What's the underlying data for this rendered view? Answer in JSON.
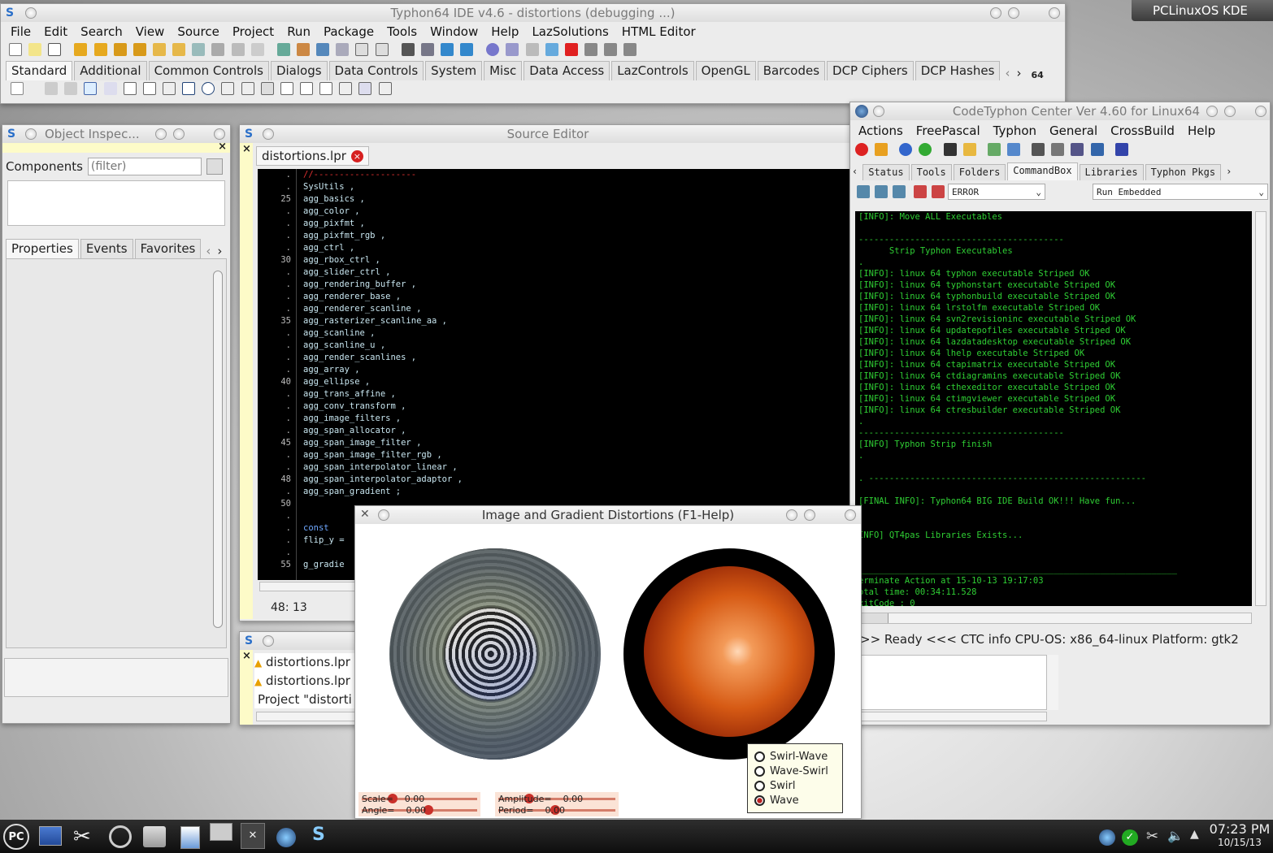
{
  "desktop": {
    "label": "PCLinuxOS KDE"
  },
  "ide": {
    "title": "Typhon64 IDE v4.6 - distortions (debugging ...)",
    "menu": [
      "File",
      "Edit",
      "Search",
      "View",
      "Source",
      "Project",
      "Run",
      "Package",
      "Tools",
      "Window",
      "Help",
      "LazSolutions",
      "HTML Editor"
    ],
    "palette_tabs": [
      "Standard",
      "Additional",
      "Common Controls",
      "Dialogs",
      "Data Controls",
      "System",
      "Misc",
      "Data Access",
      "LazControls",
      "OpenGL",
      "Barcodes",
      "DCP Ciphers",
      "DCP Hashes"
    ],
    "arch_badge": "64"
  },
  "inspector": {
    "title": "Object Inspec...",
    "components_label": "Components",
    "filter_placeholder": "(filter)",
    "tabs": [
      "Properties",
      "Events",
      "Favorites"
    ]
  },
  "editor": {
    "title": "Source Editor",
    "file_tab": "distortions.lpr",
    "status": "48: 13",
    "gutter": [
      ".",
      ".",
      "25",
      ".",
      ".",
      ".",
      ".",
      "30",
      ".",
      ".",
      ".",
      ".",
      "35",
      ".",
      ".",
      ".",
      ".",
      "40",
      ".",
      ".",
      ".",
      ".",
      "45",
      ".",
      ".",
      "48",
      ".",
      "50",
      ".",
      ".",
      ".",
      ".",
      "55"
    ],
    "lines": [
      "//--------------------",
      "SysUtils ,",
      "agg_basics ,",
      "agg_color ,",
      "agg_pixfmt ,",
      "agg_pixfmt_rgb ,",
      "agg_ctrl ,",
      "agg_rbox_ctrl ,",
      "agg_slider_ctrl ,",
      "agg_rendering_buffer ,",
      "agg_renderer_base ,",
      "agg_renderer_scanline ,",
      "agg_rasterizer_scanline_aa ,",
      "agg_scanline ,",
      "agg_scanline_u ,",
      "agg_render_scanlines ,",
      "agg_array ,",
      "agg_ellipse ,",
      "agg_trans_affine ,",
      "agg_conv_transform ,",
      "agg_image_filters ,",
      "agg_span_allocator ,",
      "agg_span_image_filter ,",
      "agg_span_image_filter_rgb ,",
      "agg_span_interpolator_linear ,",
      "agg_span_interpolator_adaptor ,",
      "agg_span_gradient ;",
      "",
      "",
      "const",
      "flip_y =",
      "",
      "g_gradie"
    ]
  },
  "messages": {
    "items": [
      "distortions.lpr",
      "distortions.lpr",
      "Project \"distorti"
    ]
  },
  "ctc": {
    "title": "CodeTyphon Center Ver 4.60 for Linux64",
    "menu": [
      "Actions",
      "FreePascal",
      "Typhon",
      "General",
      "CrossBuild",
      "Help"
    ],
    "tabs": [
      "Status",
      "Tools",
      "Folders",
      "CommandBox",
      "Libraries",
      "Typhon Pkgs"
    ],
    "level_select": "ERROR",
    "run_select": "Run Embedded",
    "console": [
      "[INFO]: Move ALL Executables",
      "",
      "----------------------------------------",
      "      Strip Typhon Executables",
      ".",
      "[INFO]: linux 64 typhon executable Striped OK",
      "[INFO]: linux 64 typhonstart executable Striped OK",
      "[INFO]: linux 64 typhonbuild executable Striped OK",
      "[INFO]: linux 64 lrstolfm executable Striped OK",
      "[INFO]: linux 64 svn2revisioninc executable Striped OK",
      "[INFO]: linux 64 updatepofiles executable Striped OK",
      "[INFO]: linux 64 lazdatadesktop executable Striped OK",
      "[INFO]: linux 64 lhelp executable Striped OK",
      "[INFO]: linux 64 ctapimatrix executable Striped OK",
      "[INFO]: linux 64 ctdiagramins executable Striped OK",
      "[INFO]: linux 64 cthexeditor executable Striped OK",
      "[INFO]: linux 64 ctimgviewer executable Striped OK",
      "[INFO]: linux 64 ctresbuilder executable Striped OK",
      ".",
      "----------------------------------------",
      "[INFO] Typhon Strip finish",
      ".",
      "",
      ". ------------------------------------------------------",
      "",
      "[FINAL INFO]: Typhon64 BIG IDE Build OK!!! Have fun...",
      "",
      "",
      "INFO] QT4pas Libraries Exists...",
      "",
      "",
      "______________________________________________________________",
      "erminate Action at 15-10-13 19:17:03",
      "otal time: 00:34:11.528",
      "xitCode : 0"
    ],
    "statusbar": ">> Ready <<<  CTC info CPU-OS: x86_64-linux Platform: gtk2"
  },
  "demo": {
    "title": "Image and Gradient Distortions (F1-Help)",
    "radio": [
      {
        "label": "Swirl-Wave",
        "checked": false
      },
      {
        "label": "Wave-Swirl",
        "checked": false
      },
      {
        "label": "Swirl",
        "checked": false
      },
      {
        "label": "Wave",
        "checked": true
      }
    ],
    "sliders": {
      "scale": "Scale=    0.00",
      "angle": "Angle=    0.00",
      "amplitude": "Amplitude=    0.00",
      "period": "Period=    0.00"
    },
    "colors": {
      "knob": "#c9302a",
      "track": "#d47d6a",
      "sphere": "#d65a14"
    }
  },
  "taskbar": {
    "time": "07:23 PM",
    "date": "10/15/13",
    "start": "PC"
  }
}
